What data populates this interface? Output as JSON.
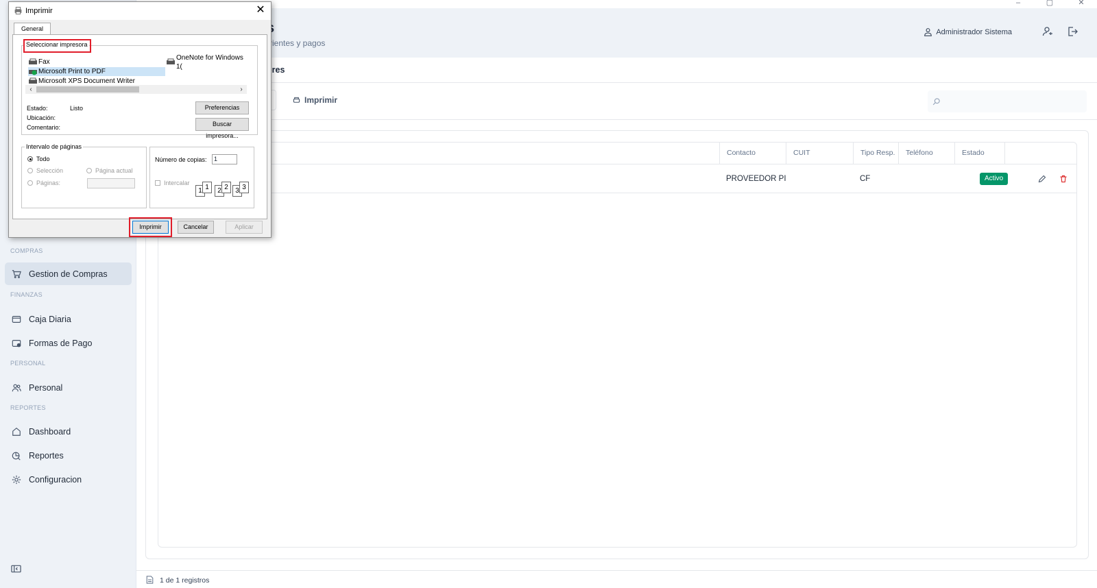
{
  "window": {
    "minimize": "–",
    "maximize": "▢",
    "close": "✕"
  },
  "header": {
    "title": "s",
    "subtitle": "rrientes y pagos",
    "user": "Administrador Sistema"
  },
  "subnav": {
    "title": "ores"
  },
  "toolbar": {
    "print_label": "Imprimir",
    "search_placeholder": ""
  },
  "sidebar": {
    "sections": [
      {
        "label": "COMPRAS",
        "items": [
          {
            "label": "Gestion de Compras",
            "icon": "cart-icon",
            "active": true
          }
        ]
      },
      {
        "label": "FINANZAS",
        "items": [
          {
            "label": "Caja Diaria",
            "icon": "cash-register-icon"
          },
          {
            "label": "Formas de Pago",
            "icon": "card-icon"
          }
        ]
      },
      {
        "label": "PERSONAL",
        "items": [
          {
            "label": "Personal",
            "icon": "users-icon"
          }
        ]
      },
      {
        "label": "REPORTES",
        "items": [
          {
            "label": "Dashboard",
            "icon": "home-icon"
          },
          {
            "label": "Reportes",
            "icon": "report-icon"
          },
          {
            "label": "Configuracion",
            "icon": "gear-icon"
          }
        ]
      }
    ]
  },
  "table": {
    "columns": [
      "Contacto",
      "CUIT",
      "Tipo Resp.",
      "Teléfono",
      "Estado"
    ],
    "rows": [
      {
        "contacto": "PROVEEDOR PI",
        "cuit": "",
        "tipo_resp": "CF",
        "telefono": "",
        "estado": "Activo"
      }
    ]
  },
  "footer": {
    "records": "1 de 1 registros"
  },
  "colors": {
    "accent_green": "#059669",
    "delete_red": "#dc2626",
    "highlight_red": "#e11d2a",
    "sidebar_bg": "#eef2f7"
  },
  "dialog": {
    "title": "Imprimir",
    "tab": "General",
    "printer_group_label": "Seleccionar impresora",
    "printers": [
      "Fax",
      "OneNote for Windows 1(",
      "Microsoft Print to PDF",
      "Microsoft XPS Document Writer"
    ],
    "selected_printer": "Microsoft Print to PDF",
    "estado_label": "Estado:",
    "estado_value": "Listo",
    "ubicacion_label": "Ubicación:",
    "comentario_label": "Comentario:",
    "preferencias_button": "Preferencias",
    "buscar_button": "Buscar impresora...",
    "range_group_label": "Intervalo de páginas",
    "range_todo": "Todo",
    "range_seleccion": "Selección",
    "range_pagina_actual": "Página actual",
    "range_paginas": "Páginas:",
    "copies_label": "Número de copias:",
    "copies_value": "1",
    "collate_label": "Intercalar",
    "collate_pages": [
      "1",
      "1",
      "2",
      "2",
      "3",
      "3"
    ],
    "print_button": "Imprimir",
    "cancel_button": "Cancelar",
    "apply_button": "Aplicar"
  }
}
